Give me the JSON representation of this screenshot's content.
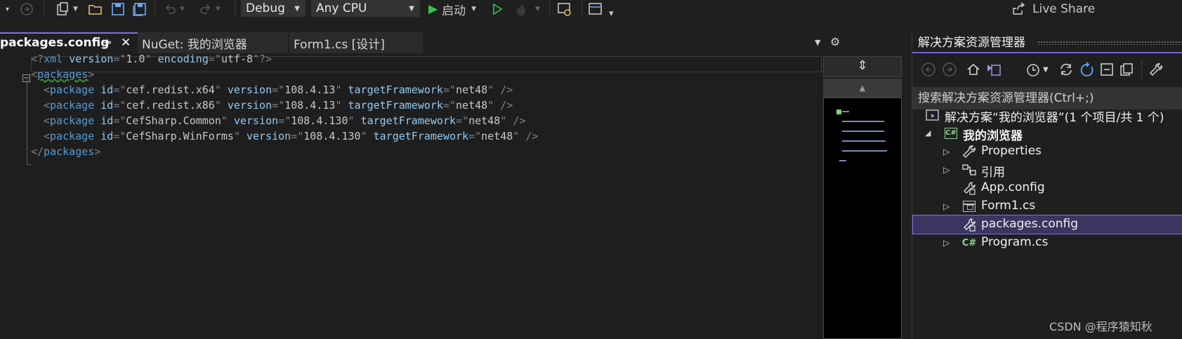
{
  "toolbar": {
    "config_combo": "Debug",
    "platform_combo": "Any CPU",
    "start_label": "启动",
    "live_share": "Live Share"
  },
  "tabs": [
    {
      "label": "packages.config",
      "pin": "⊸",
      "close": "✕"
    },
    {
      "label": "NuGet: 我的浏览器"
    },
    {
      "label": "Form1.cs [设计]"
    }
  ],
  "editor": {
    "lines": [
      {
        "decl_open": "<?",
        "decl_name": "xml",
        "a1": "version",
        "v1": "1.0",
        "a2": "encoding",
        "v2": "utf-8",
        "decl_close": "?>"
      },
      {
        "open": "<",
        "tag": "packages",
        "close": ">"
      },
      {
        "tag": "package",
        "id": "cef.redist.x64",
        "version": "108.4.13",
        "fw": "net48"
      },
      {
        "tag": "package",
        "id": "cef.redist.x86",
        "version": "108.4.13",
        "fw": "net48"
      },
      {
        "tag": "package",
        "id": "CefSharp.Common",
        "version": "108.4.130",
        "fw": "net48"
      },
      {
        "tag": "package",
        "id": "CefSharp.WinForms",
        "version": "108.4.130",
        "fw": "net48"
      },
      {
        "open": "</",
        "tag": "packages",
        "close": ">"
      }
    ],
    "attr_id": "id",
    "attr_version": "version",
    "attr_fw": "targetFramework",
    "collapse_glyph": "−"
  },
  "solution_explorer": {
    "title": "解决方案资源管理器",
    "search_placeholder": "搜索解决方案资源管理器(Ctrl+;)",
    "tree": {
      "solution": "解决方案“我的浏览器”(1 个项目/共 1 个)",
      "project": "我的浏览器",
      "properties": "Properties",
      "references": "引用",
      "app_config": "App.config",
      "form1": "Form1.cs",
      "packages_config": "packages.config",
      "program": "Program.cs"
    },
    "project_badge": "C#",
    "file_badge": "C#"
  },
  "watermark": "CSDN @程序猿知秋",
  "colors": {
    "accent": "#7160d8",
    "selection": "#3a3561",
    "tag": "#569cd6",
    "attr": "#92caf4",
    "string": "#d69d85"
  }
}
